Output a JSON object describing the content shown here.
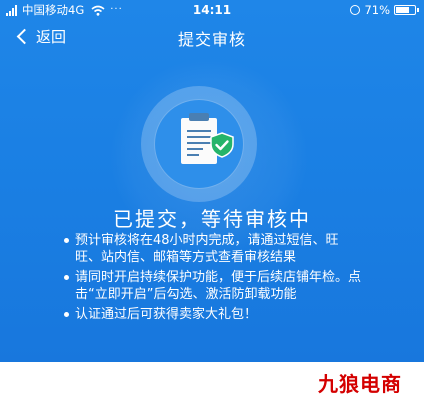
{
  "status_bar": {
    "carrier": "中国移动4G",
    "time": "14:11",
    "battery": "71%",
    "dots": "···"
  },
  "nav": {
    "back_label": "返回",
    "title": "提交审核"
  },
  "main": {
    "heading": "已提交，等待审核中",
    "notes": [
      "预计审核将在48小时内完成，请通过短信、旺旺、站内信、邮箱等方式查看审核结果",
      "请同时开启持续保护功能，便于后续店铺年检。点击“立即开启”后勾选、激活防卸载功能",
      "认证通过后可获得卖家大礼包！"
    ]
  },
  "watermark": "九狼电商",
  "colors": {
    "background_blue": "#1a7fe3",
    "shield_green": "#25b46a",
    "watermark_red": "#d40000"
  },
  "icons": {
    "hero": "document-with-shield-check-icon",
    "back": "chevron-left-icon"
  }
}
